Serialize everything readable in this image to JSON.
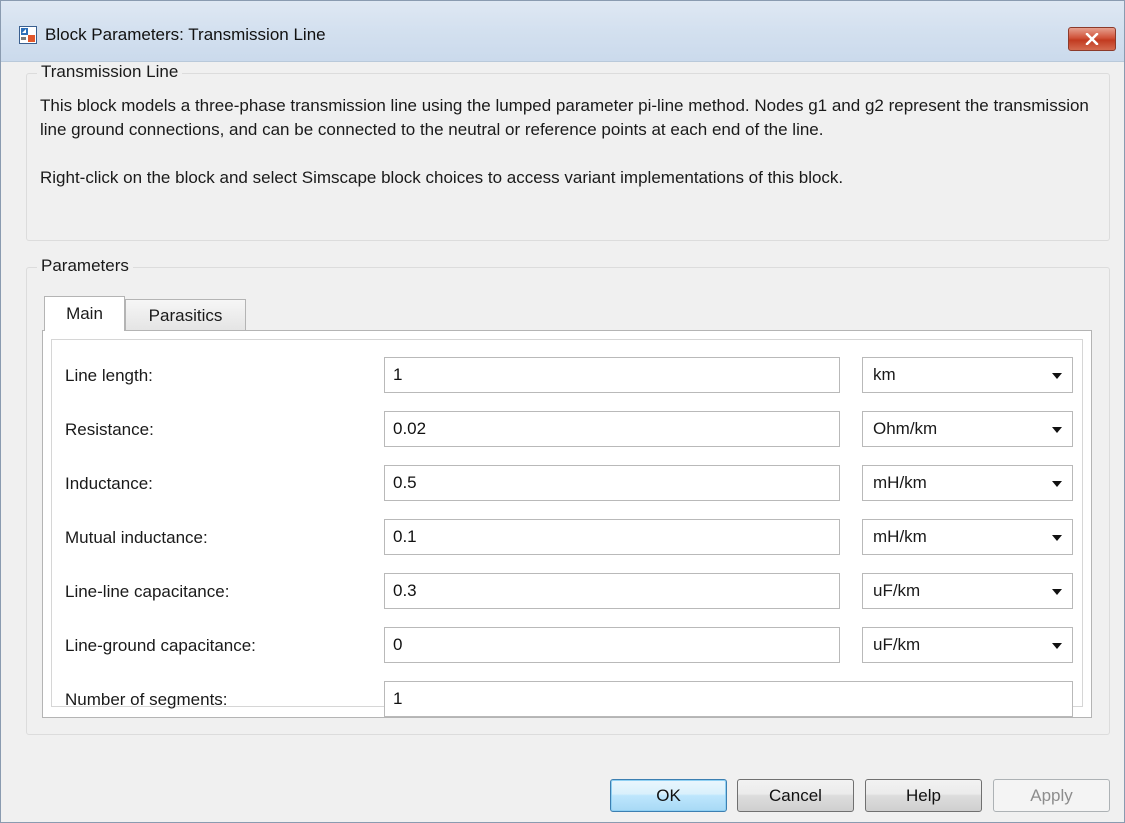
{
  "window": {
    "title": "Block Parameters: Transmission Line"
  },
  "description": {
    "legend": "Transmission Line",
    "paragraph1": "This block models a three-phase transmission line using the lumped parameter pi-line method. Nodes g1 and g2 represent the transmission line ground connections, and can be connected to the neutral or reference points at each end of the line.",
    "paragraph2": "Right-click on the block and select Simscape block choices to access variant implementations of this block."
  },
  "parameters": {
    "legend": "Parameters",
    "tabs": [
      {
        "label": "Main",
        "active": true
      },
      {
        "label": "Parasitics",
        "active": false
      }
    ],
    "rows": [
      {
        "label": "Line length:",
        "value": "1",
        "unit": "km"
      },
      {
        "label": "Resistance:",
        "value": "0.02",
        "unit": "Ohm/km"
      },
      {
        "label": "Inductance:",
        "value": "0.5",
        "unit": "mH/km"
      },
      {
        "label": "Mutual inductance:",
        "value": "0.1",
        "unit": "mH/km"
      },
      {
        "label": "Line-line capacitance:",
        "value": "0.3",
        "unit": "uF/km"
      },
      {
        "label": "Line-ground capacitance:",
        "value": "0",
        "unit": "uF/km"
      },
      {
        "label": "Number of segments:",
        "value": "1"
      }
    ]
  },
  "buttons": {
    "ok": "OK",
    "cancel": "Cancel",
    "help": "Help",
    "apply": "Apply"
  },
  "colors": {
    "titlebar": "#d3e0ef",
    "close_button": "#c94a30",
    "default_button": "#bee6fd",
    "dialog_background": "#f0f0f0"
  }
}
